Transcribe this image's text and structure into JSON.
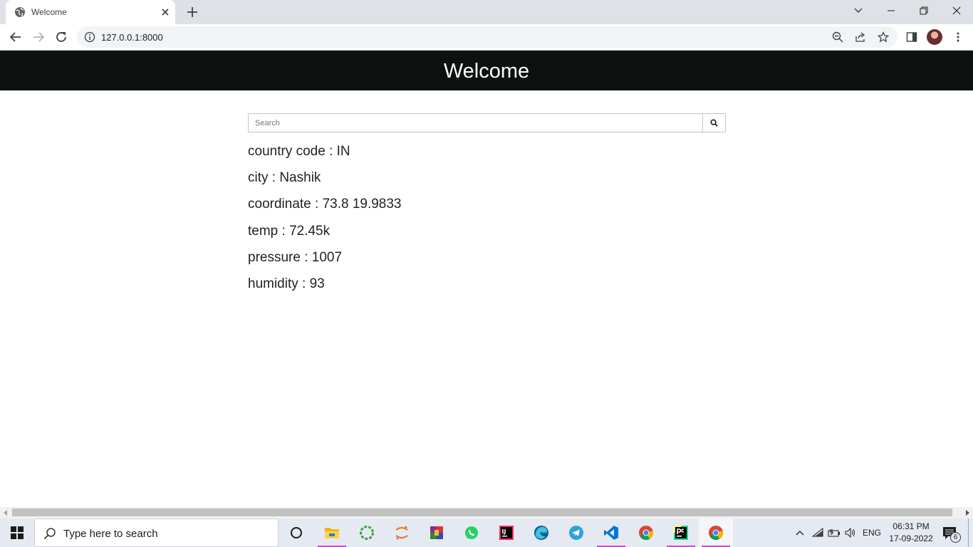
{
  "browser": {
    "tab_title": "Welcome",
    "url": "127.0.0.1:8000"
  },
  "page": {
    "heading": "Welcome",
    "search": {
      "placeholder": "Search"
    },
    "info_rows": [
      "country code : IN",
      "city : Nashik",
      "coordinate : 73.8 19.9833",
      "temp : 72.45k",
      "pressure : 1007",
      "humidity : 93"
    ]
  },
  "taskbar": {
    "search_placeholder": "Type here to search",
    "language": "ENG",
    "time": "06:31 PM",
    "date": "17-09-2022",
    "notification_count": "6",
    "apps": [
      "cortana",
      "file-explorer",
      "green-ring-app",
      "jupyter",
      "winrar",
      "whatsapp",
      "intellij-idea",
      "edge",
      "telegram",
      "vscode",
      "chrome",
      "pycharm",
      "chrome"
    ]
  },
  "colors": {
    "header_bg": "#0d110f",
    "accent_underline": "#c052c0"
  }
}
